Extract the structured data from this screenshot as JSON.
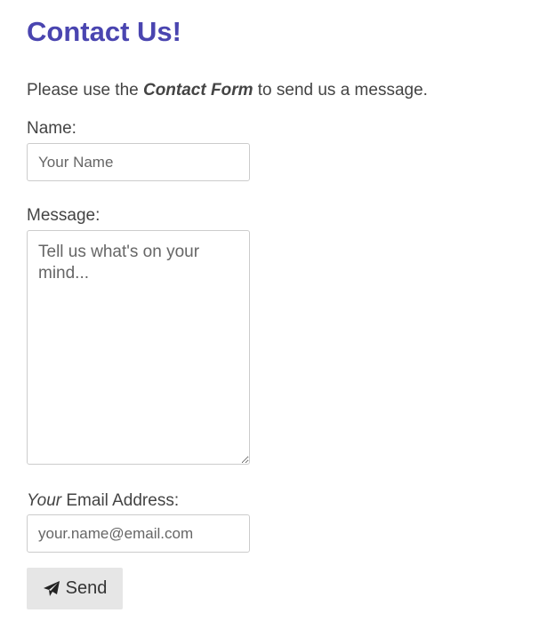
{
  "heading": "Contact Us!",
  "intro": {
    "before": "Please use the ",
    "emphasis": "Contact Form",
    "after": " to send us a message."
  },
  "name_field": {
    "label": "Name:",
    "placeholder": "Your Name"
  },
  "message_field": {
    "label": "Message:",
    "placeholder": "Tell us what's on your mind..."
  },
  "email_field": {
    "label_emphasis": "Your",
    "label_rest": " Email Address:",
    "placeholder": "your.name@email.com"
  },
  "send_button": {
    "label": "Send",
    "icon": "paper-plane-icon"
  },
  "colors": {
    "heading": "#4a45b0",
    "text": "#444444",
    "button_bg": "#e6e6e6",
    "field_border": "#cccccc"
  }
}
